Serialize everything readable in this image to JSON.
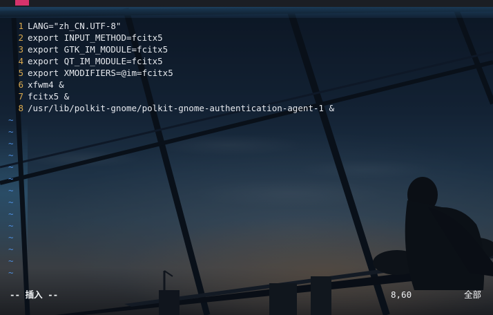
{
  "editor": {
    "lines": [
      {
        "num": "1",
        "text": "LANG=\"zh_CN.UTF-8\""
      },
      {
        "num": "2",
        "text": "export INPUT_METHOD=fcitx5"
      },
      {
        "num": "3",
        "text": "export GTK_IM_MODULE=fcitx5"
      },
      {
        "num": "4",
        "text": "export QT_IM_MODULE=fcitx5"
      },
      {
        "num": "5",
        "text": "export XMODIFIERS=@im=fcitx5"
      },
      {
        "num": "6",
        "text": "xfwm4 &"
      },
      {
        "num": "7",
        "text": "fcitx5 &"
      },
      {
        "num": "8",
        "text": "/usr/lib/polkit-gnome/polkit-gnome-authentication-agent-1 &"
      }
    ],
    "empty_marker": "~",
    "empty_count": 14
  },
  "status": {
    "mode": "-- 插入 --",
    "position": "8,60",
    "scroll": "全部"
  },
  "colors": {
    "line_number": "#d9a94e",
    "tilde": "#4f8fe0",
    "text": "#e6e9ee",
    "accent": "#d6336c"
  }
}
